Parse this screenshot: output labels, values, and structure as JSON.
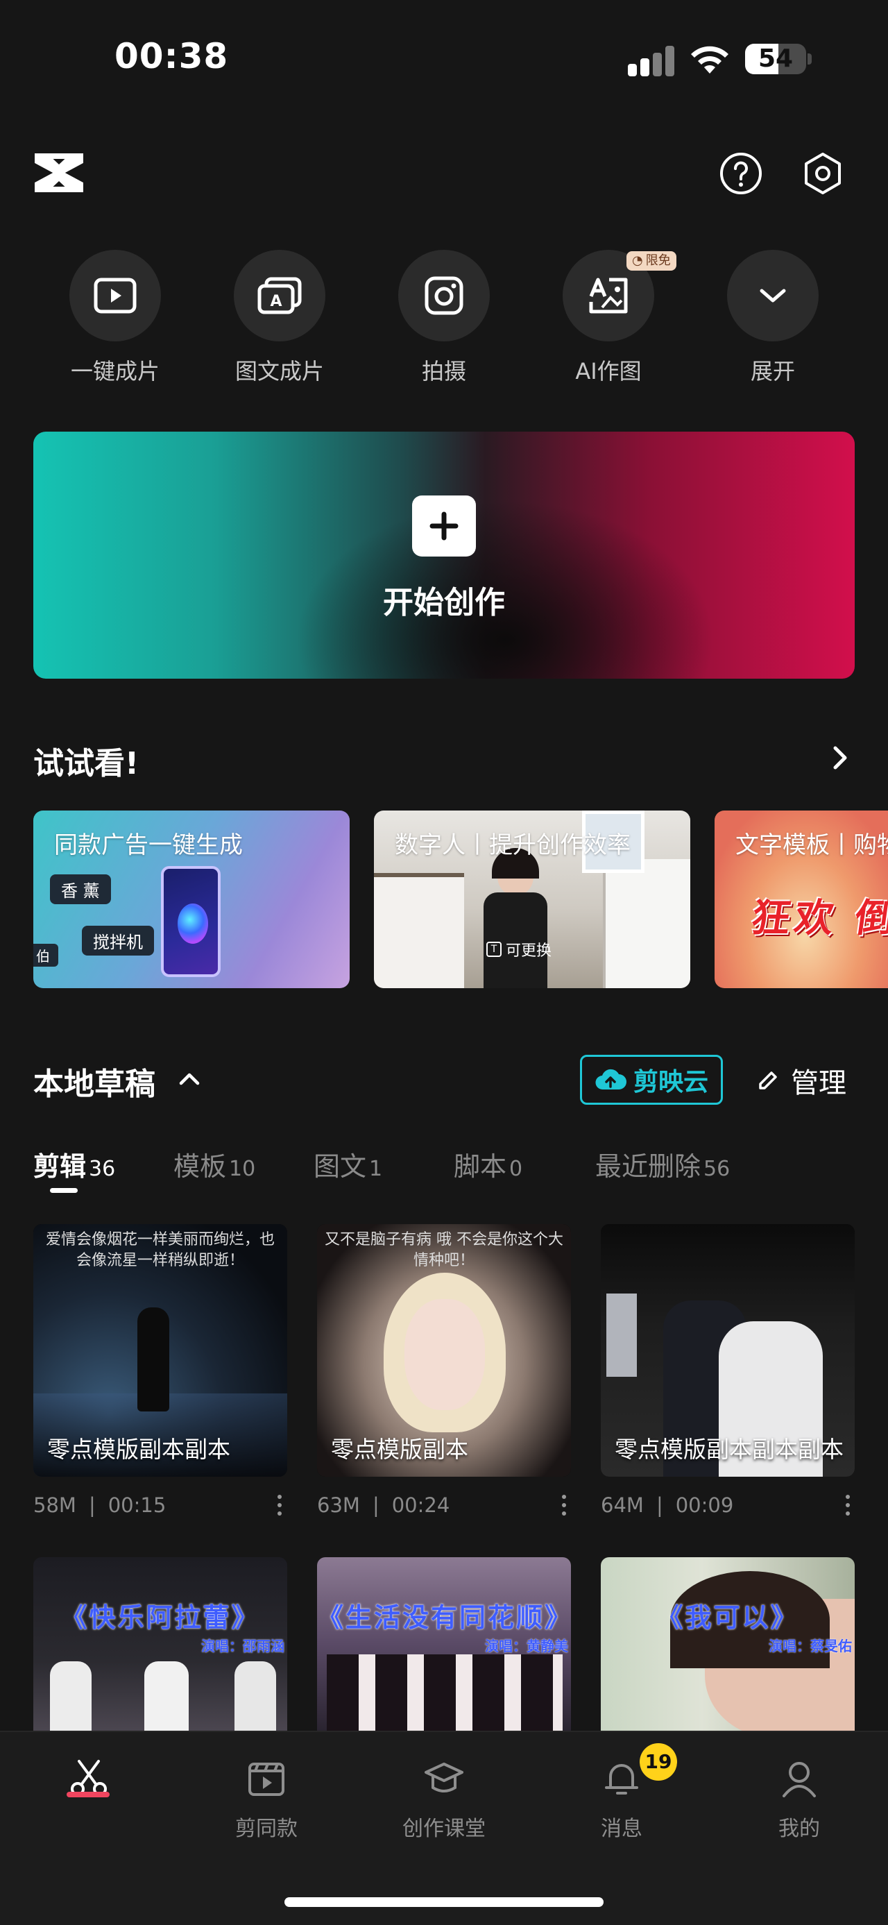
{
  "status_bar": {
    "time": "00:38",
    "battery": "54",
    "battery_level": 0.54
  },
  "header": {
    "logo_icon": "capcut-logo-icon",
    "help_icon": "help-icon",
    "settings_icon": "settings-icon"
  },
  "quick_actions": [
    {
      "label": "一键成片",
      "icon": "play-square-icon"
    },
    {
      "label": "图文成片",
      "icon": "image-text-icon"
    },
    {
      "label": "拍摄",
      "icon": "camera-icon"
    },
    {
      "label": "AI作图",
      "icon": "ai-draw-icon",
      "badge": "限免"
    },
    {
      "label": "展开",
      "icon": "chevron-down-icon"
    }
  ],
  "start": {
    "label": "开始创作"
  },
  "try_section": {
    "title": "试试看!",
    "cards": [
      {
        "title": "同款广告一键生成",
        "tags": [
          "香 薰",
          "搅拌机",
          "伯"
        ]
      },
      {
        "title": "数字人丨提升创作效率",
        "overlay": "可更换"
      },
      {
        "title": "文字模板丨购物",
        "overlay": "狂欢 倒"
      }
    ]
  },
  "drafts": {
    "title": "本地草稿",
    "cloud_label": "剪映云",
    "manage_label": "管理",
    "tabs": [
      {
        "label": "剪辑",
        "count": "36"
      },
      {
        "label": "模板",
        "count": "10"
      },
      {
        "label": "图文",
        "count": "1"
      },
      {
        "label": "脚本",
        "count": "0"
      },
      {
        "label": "最近删除",
        "count": "56"
      }
    ],
    "items": [
      {
        "name": "零点模版副本副本",
        "size": "58M",
        "duration": "00:15",
        "caption": "爱情会像烟花一样美丽而绚烂，也会像流星一样稍纵即逝！"
      },
      {
        "name": "零点模版副本",
        "size": "63M",
        "duration": "00:24",
        "caption": "又不是脑子有病 哦 不会是你这个大情种吧！"
      },
      {
        "name": "零点模版副本副本副本",
        "size": "64M",
        "duration": "00:09",
        "caption": ""
      }
    ],
    "items_row2": [
      {
        "song": "《快乐阿拉蕾》",
        "singer": "演唱：邵雨涵"
      },
      {
        "song": "《生活没有同花顺》",
        "singer": "演唱：黄静美"
      },
      {
        "song": "《我可以》",
        "singer": "演唱：蔡旻佑"
      }
    ]
  },
  "bottom_nav": [
    {
      "label": "",
      "icon": "scissors-icon",
      "active": true
    },
    {
      "label": "剪同款",
      "icon": "template-clapper-icon"
    },
    {
      "label": "创作课堂",
      "icon": "graduation-cap-icon"
    },
    {
      "label": "消息",
      "icon": "bell-icon",
      "badge": "19"
    },
    {
      "label": "我的",
      "icon": "user-icon"
    }
  ],
  "colors": {
    "accent_cyan": "#1fc7d6",
    "accent_red": "#f0455f",
    "badge_yellow": "#ffd21a"
  }
}
